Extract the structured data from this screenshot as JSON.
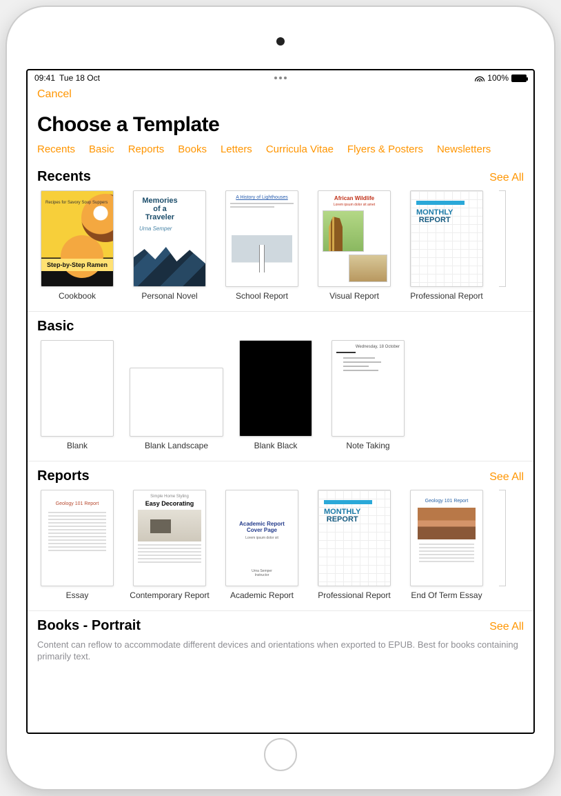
{
  "status": {
    "time": "09:41",
    "date": "Tue 18 Oct",
    "battery": "100%"
  },
  "nav": {
    "cancel": "Cancel"
  },
  "title": "Choose a Template",
  "tabs": [
    "Recents",
    "Basic",
    "Reports",
    "Books",
    "Letters",
    "Curricula Vitae",
    "Flyers & Posters",
    "Newsletters"
  ],
  "seeAll": "See All",
  "sections": {
    "recents": {
      "title": "Recents",
      "items": [
        {
          "label": "Cookbook",
          "band": "Step-by-Step Ramen",
          "tag": "Recipes for Savory Soup Suppers"
        },
        {
          "label": "Personal Novel",
          "t1": "Memories of a Traveler",
          "t2": "Urna Semper"
        },
        {
          "label": "School Report",
          "h": "A History of Lighthouses"
        },
        {
          "label": "Visual Report",
          "h": "African Wildlife",
          "sub": "Lorem ipsum dolor sit amet"
        },
        {
          "label": "Professional Report",
          "t": "MONTHLY",
          "t2": "REPORT"
        }
      ]
    },
    "basic": {
      "title": "Basic",
      "items": [
        {
          "label": "Blank"
        },
        {
          "label": "Blank Landscape"
        },
        {
          "label": "Blank Black"
        },
        {
          "label": "Note Taking"
        }
      ]
    },
    "reports": {
      "title": "Reports",
      "items": [
        {
          "label": "Essay",
          "h": "Geology 101 Report"
        },
        {
          "label": "Contemporary Report",
          "h": "Simple Home Styling",
          "t": "Easy Decorating"
        },
        {
          "label": "Academic Report",
          "t": "Academic Report Cover Page"
        },
        {
          "label": "Professional Report",
          "t": "MONTHLY",
          "t2": "REPORT"
        },
        {
          "label": "End Of Term Essay",
          "t": "Geology 101 Report"
        }
      ]
    },
    "books": {
      "title": "Books - Portrait",
      "desc": "Content can reflow to accommodate different devices and orientations when exported to EPUB. Best for books containing primarily text."
    }
  }
}
